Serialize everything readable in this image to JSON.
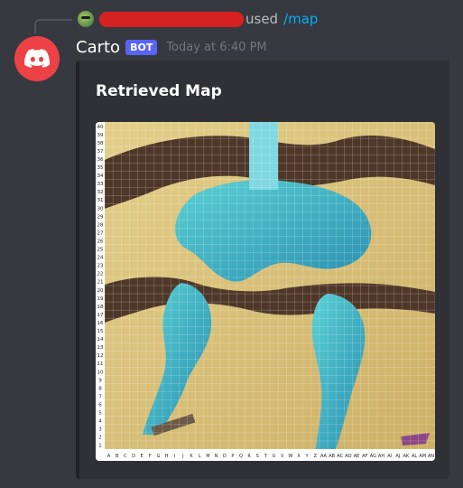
{
  "reply": {
    "used_text": "used",
    "command": "/map"
  },
  "message": {
    "username": "Carto",
    "bot_tag": "BOT",
    "timestamp": "Today at 6:40 PM"
  },
  "embed": {
    "title": "Retrieved Map"
  },
  "map": {
    "x_labels": [
      "A",
      "B",
      "C",
      "D",
      "E",
      "F",
      "G",
      "H",
      "I",
      "J",
      "K",
      "L",
      "M",
      "N",
      "O",
      "P",
      "Q",
      "R",
      "S",
      "T",
      "U",
      "V",
      "W",
      "X",
      "Y",
      "Z",
      "AA",
      "AB",
      "AC",
      "AD",
      "AE",
      "AF",
      "AG",
      "AH",
      "AI",
      "AJ",
      "AK",
      "AL",
      "AM",
      "AN"
    ],
    "y_labels": [
      "40",
      "39",
      "38",
      "37",
      "36",
      "35",
      "34",
      "33",
      "32",
      "31",
      "30",
      "29",
      "28",
      "27",
      "26",
      "25",
      "24",
      "23",
      "22",
      "21",
      "20",
      "19",
      "18",
      "17",
      "16",
      "15",
      "14",
      "13",
      "12",
      "11",
      "10",
      "9",
      "8",
      "7",
      "6",
      "5",
      "4",
      "3",
      "2",
      "1"
    ]
  },
  "colors": {
    "background": "#36393f",
    "embed_background": "#2f3136",
    "bot_tag": "#5865f2",
    "avatar": "#ed4245",
    "command_link": "#00aff4",
    "redaction": "#d42121"
  }
}
